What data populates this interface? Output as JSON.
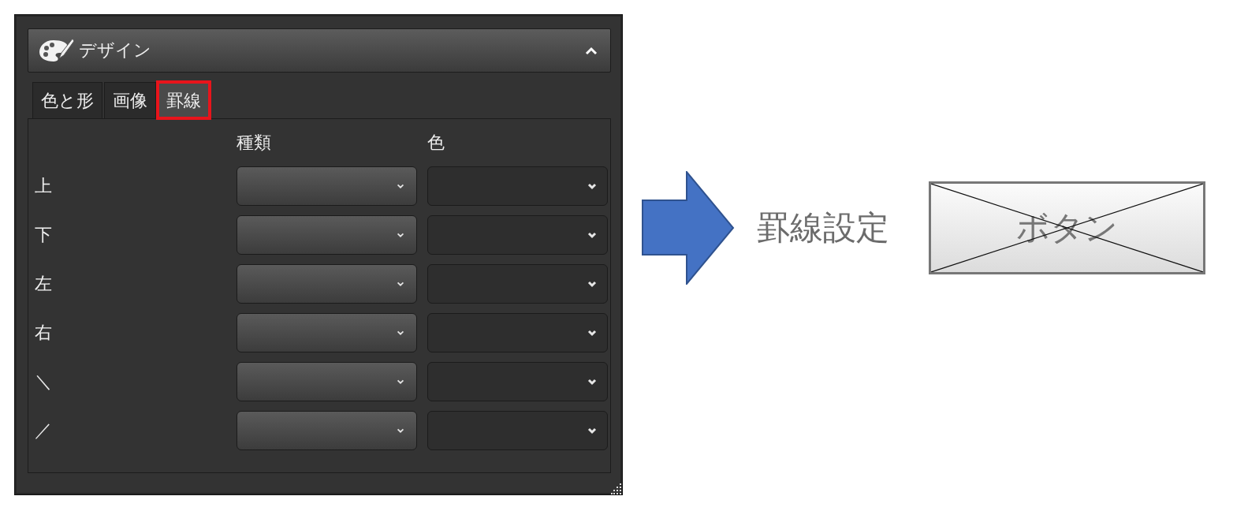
{
  "panel": {
    "title": "デザイン",
    "expanded": true,
    "tabs": [
      {
        "label": "色と形",
        "selected": false,
        "outlined": false
      },
      {
        "label": "画像",
        "selected": false,
        "outlined": false
      },
      {
        "label": "罫線",
        "selected": true,
        "outlined": true
      }
    ],
    "columns": [
      "種類",
      "色"
    ],
    "rows": [
      {
        "label": "上"
      },
      {
        "label": "下"
      },
      {
        "label": "左"
      },
      {
        "label": "右"
      },
      {
        "label": "＼"
      },
      {
        "label": "／"
      }
    ]
  },
  "annotation": {
    "caption": "罫線設定",
    "mockup_button": {
      "label": "ボタン",
      "crossed": true
    }
  }
}
